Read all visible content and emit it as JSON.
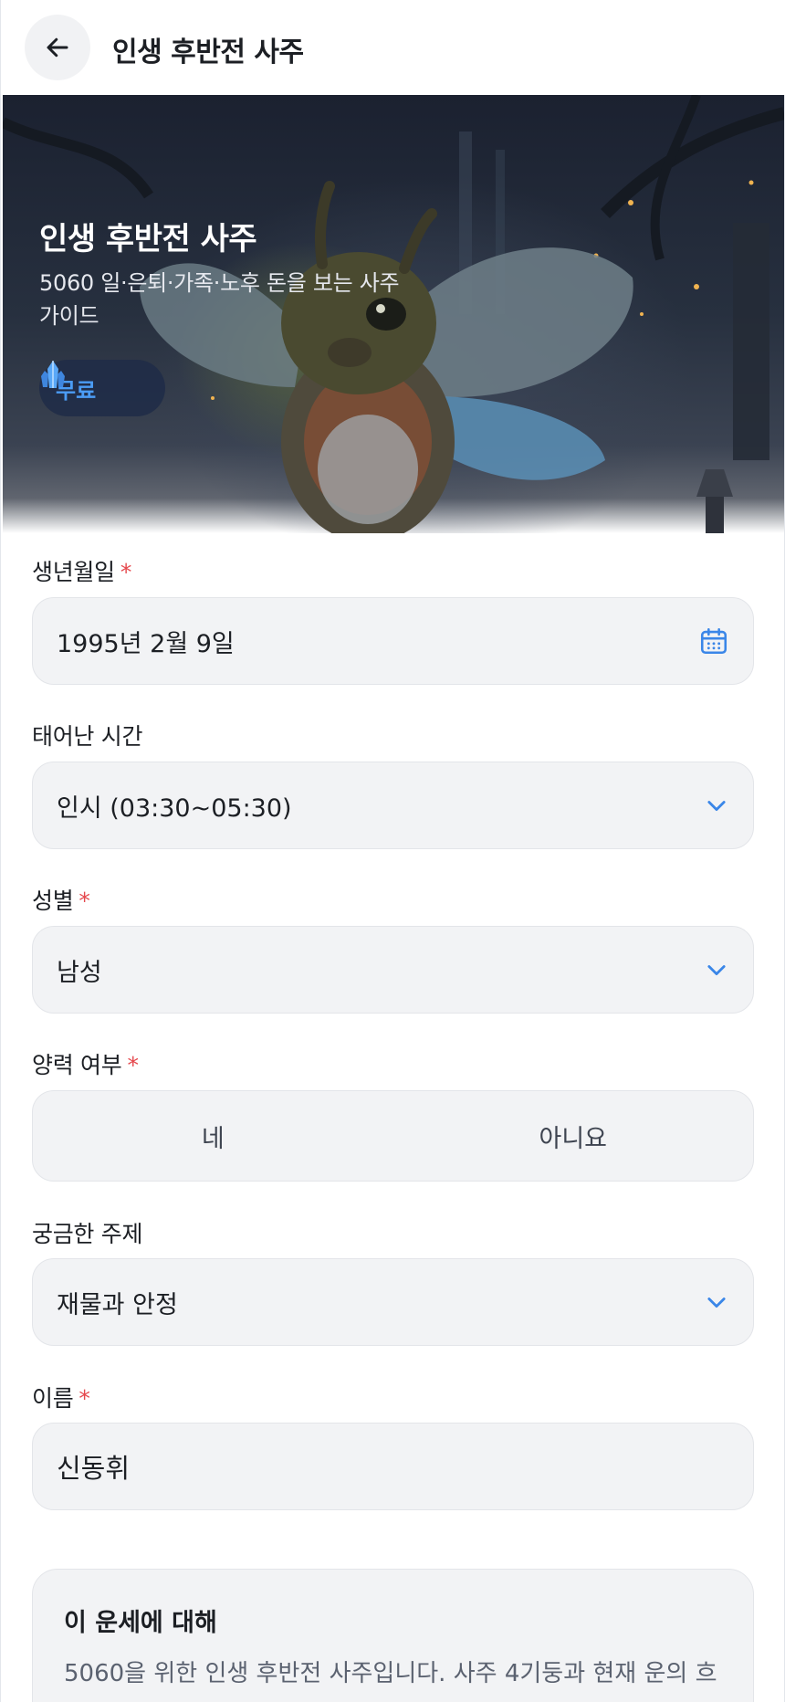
{
  "header": {
    "title": "인생 후반전 사주",
    "back_icon": "arrow-left-icon"
  },
  "hero": {
    "title": "인생 후반전 사주",
    "subtitle": "5060 일·은퇴·가족·노후 돈을 보는 사주 가이드",
    "badge_label": "무료",
    "badge_icon": "crystal-icon"
  },
  "form": {
    "birthdate": {
      "label": "생년월일",
      "required": "*",
      "value": "1995년 2월 9일",
      "icon": "calendar-icon"
    },
    "birthtime": {
      "label": "태어난 시간",
      "value": "인시 (03:30~05:30)",
      "icon": "chevron-down-icon"
    },
    "gender": {
      "label": "성별",
      "required": "*",
      "value": "남성",
      "icon": "chevron-down-icon"
    },
    "solar": {
      "label": "양력 여부",
      "required": "*",
      "options": [
        "네",
        "아니요"
      ]
    },
    "topic": {
      "label": "궁금한 주제",
      "value": "재물과 안정",
      "icon": "chevron-down-icon"
    },
    "name": {
      "label": "이름",
      "required": "*",
      "value": "신동휘"
    }
  },
  "about": {
    "title": "이 운세에 대해",
    "body": "5060을 위한 인생 후반전 사주입니다. 사주 4기둥과 현재 운의 흐"
  },
  "colors": {
    "accent": "#4b9cf5",
    "required": "#e5484d",
    "field_bg": "#f2f3f5"
  }
}
